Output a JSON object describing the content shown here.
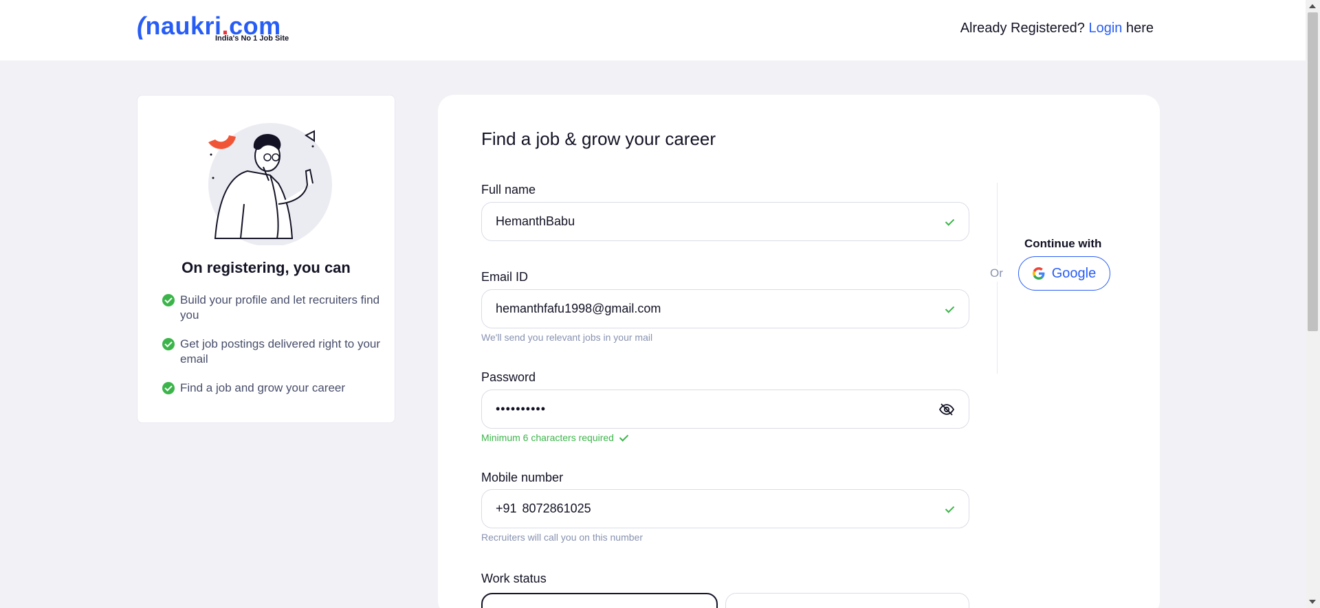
{
  "header": {
    "logo_text": "naukri",
    "logo_dot": ".",
    "logo_com": "com",
    "logo_tagline": "India's No 1 Job Site",
    "already_registered": "Already Registered?",
    "login_link": "Login",
    "login_suffix": "here"
  },
  "info_card": {
    "title": "On registering, you can",
    "benefits": [
      "Build your profile and let recruiters find you",
      "Get job postings delivered right to your email",
      "Find a job and grow your career"
    ]
  },
  "form": {
    "title": "Find a job & grow your career",
    "full_name": {
      "label": "Full name",
      "value": "HemanthBabu"
    },
    "email": {
      "label": "Email ID",
      "value": "hemanthfafu1998@gmail.com",
      "helper": "We'll send you relevant jobs in your mail"
    },
    "password": {
      "label": "Password",
      "value": "••••••••••",
      "helper": "Minimum 6 characters required"
    },
    "mobile": {
      "label": "Mobile number",
      "prefix": "+91",
      "value": "8072861025",
      "helper": "Recruiters will call you on this number"
    },
    "work_status": {
      "label": "Work status"
    }
  },
  "social": {
    "or_text": "Or",
    "continue_text": "Continue with",
    "google_label": "Google"
  },
  "colors": {
    "brand_blue": "#275df5",
    "success_green": "#3bb54a",
    "page_bg": "#f2f2f6"
  }
}
